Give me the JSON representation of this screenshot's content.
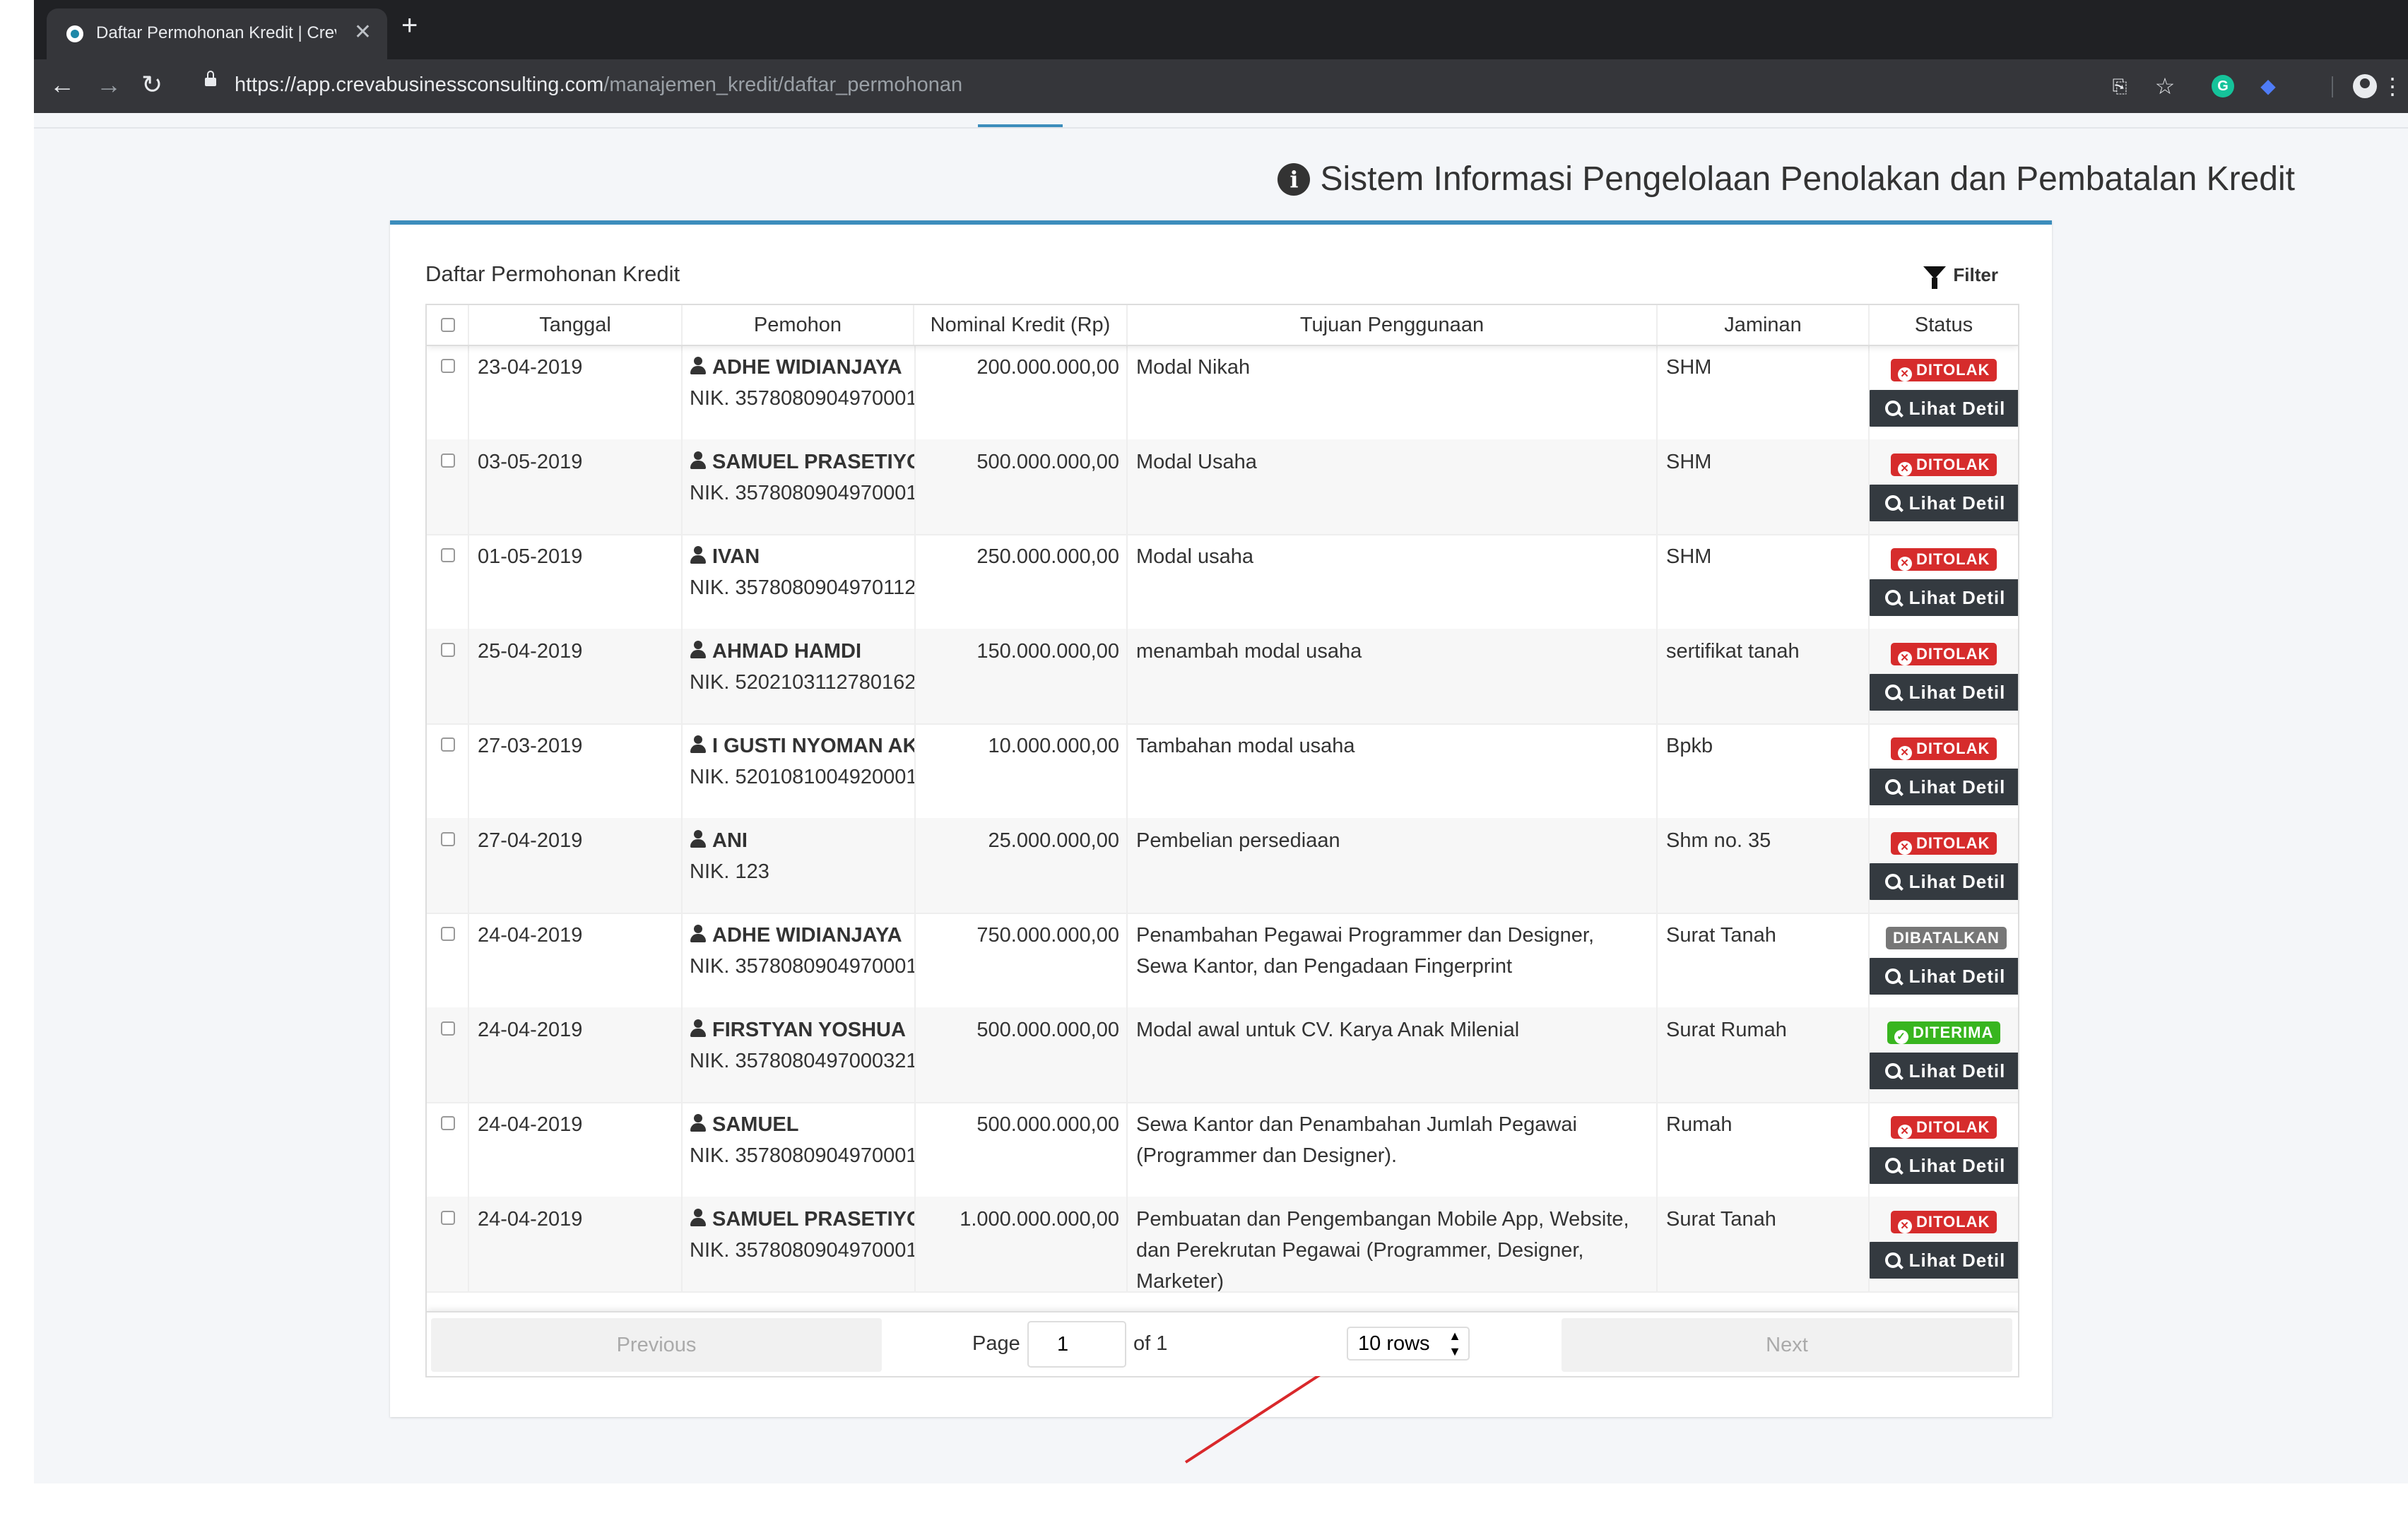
{
  "browser": {
    "tab_title": "Daftar Permohonan Kredit | Creva",
    "url_domain": "https://app.crevabusinessconsulting.com",
    "url_path": "/manajemen_kredit/daftar_permohonan",
    "new_tab": "+",
    "close": "✕"
  },
  "page": {
    "heading": "Sistem Informasi Pengelolaan Penolakan dan Pembatalan Kredit",
    "card_title": "Daftar Permohonan Kredit",
    "filter_label": "Filter"
  },
  "table": {
    "columns": [
      "Tanggal",
      "Pemohon",
      "Nominal Kredit (Rp)",
      "Tujuan Penggunaan",
      "Jaminan",
      "Status"
    ],
    "detail_label": "Lihat Detil",
    "rows": [
      {
        "date": "23-04-2019",
        "name": "ADHE WIDIANJAYA",
        "nik": "NIK. 3578080904970001",
        "amount": "200.000.000,00",
        "purpose": "Modal Nikah",
        "collateral": "SHM",
        "status": "DITOLAK"
      },
      {
        "date": "03-05-2019",
        "name": "SAMUEL PRASETIYO",
        "nik": "NIK. 3578080904970001",
        "amount": "500.000.000,00",
        "purpose": "Modal Usaha",
        "collateral": "SHM",
        "status": "DITOLAK"
      },
      {
        "date": "01-05-2019",
        "name": "IVAN",
        "nik": "NIK. 3578080904970112",
        "amount": "250.000.000,00",
        "purpose": "Modal usaha",
        "collateral": "SHM",
        "status": "DITOLAK"
      },
      {
        "date": "25-04-2019",
        "name": "AHMAD HAMDI",
        "nik": "NIK. 5202103112780162",
        "amount": "150.000.000,00",
        "purpose": "menambah modal usaha",
        "collateral": "sertifikat tanah",
        "status": "DITOLAK"
      },
      {
        "date": "27-03-2019",
        "name": "I GUSTI NYOMAN AKSARA",
        "nik": "NIK. 5201081004920001",
        "amount": "10.000.000,00",
        "purpose": "Tambahan modal usaha",
        "collateral": "Bpkb",
        "status": "DITOLAK"
      },
      {
        "date": "27-04-2019",
        "name": "ANI",
        "nik": "NIK. 123",
        "amount": "25.000.000,00",
        "purpose": "Pembelian persediaan",
        "collateral": "Shm no. 35",
        "status": "DITOLAK"
      },
      {
        "date": "24-04-2019",
        "name": "ADHE WIDIANJAYA",
        "nik": "NIK. 3578080904970001",
        "amount": "750.000.000,00",
        "purpose": "Penambahan Pegawai Programmer dan Designer, Sewa Kantor, dan Pengadaan Fingerprint",
        "collateral": "Surat Tanah",
        "status": "DIBATALKAN"
      },
      {
        "date": "24-04-2019",
        "name": "FIRSTYAN YOSHUA",
        "nik": "NIK. 3578080497000321",
        "amount": "500.000.000,00",
        "purpose": "Modal awal untuk CV. Karya Anak Milenial",
        "collateral": "Surat Rumah",
        "status": "DITERIMA"
      },
      {
        "date": "24-04-2019",
        "name": "SAMUEL",
        "nik": "NIK. 3578080904970001",
        "amount": "500.000.000,00",
        "purpose": "Sewa Kantor dan Penambahan Jumlah Pegawai (Programmer dan Designer).",
        "collateral": "Rumah",
        "status": "DITOLAK"
      },
      {
        "date": "24-04-2019",
        "name": "SAMUEL PRASETIYO",
        "nik": "NIK. 3578080904970001",
        "amount": "1.000.000.000,00",
        "purpose": "Pembuatan dan Pengembangan Mobile App, Website, dan Perekrutan Pegawai (Programmer, Designer, Marketer)",
        "collateral": "Surat Tanah",
        "status": "DITOLAK"
      }
    ]
  },
  "pagination": {
    "previous": "Previous",
    "next": "Next",
    "page_label": "Page",
    "page_value": "1",
    "of_label": "of 1",
    "rows_option": "10 rows"
  },
  "colors": {
    "ditolak": "#d62c2c",
    "dibatalkan": "#777777",
    "diterima": "#38b51f",
    "accent": "#3c8dbc"
  }
}
